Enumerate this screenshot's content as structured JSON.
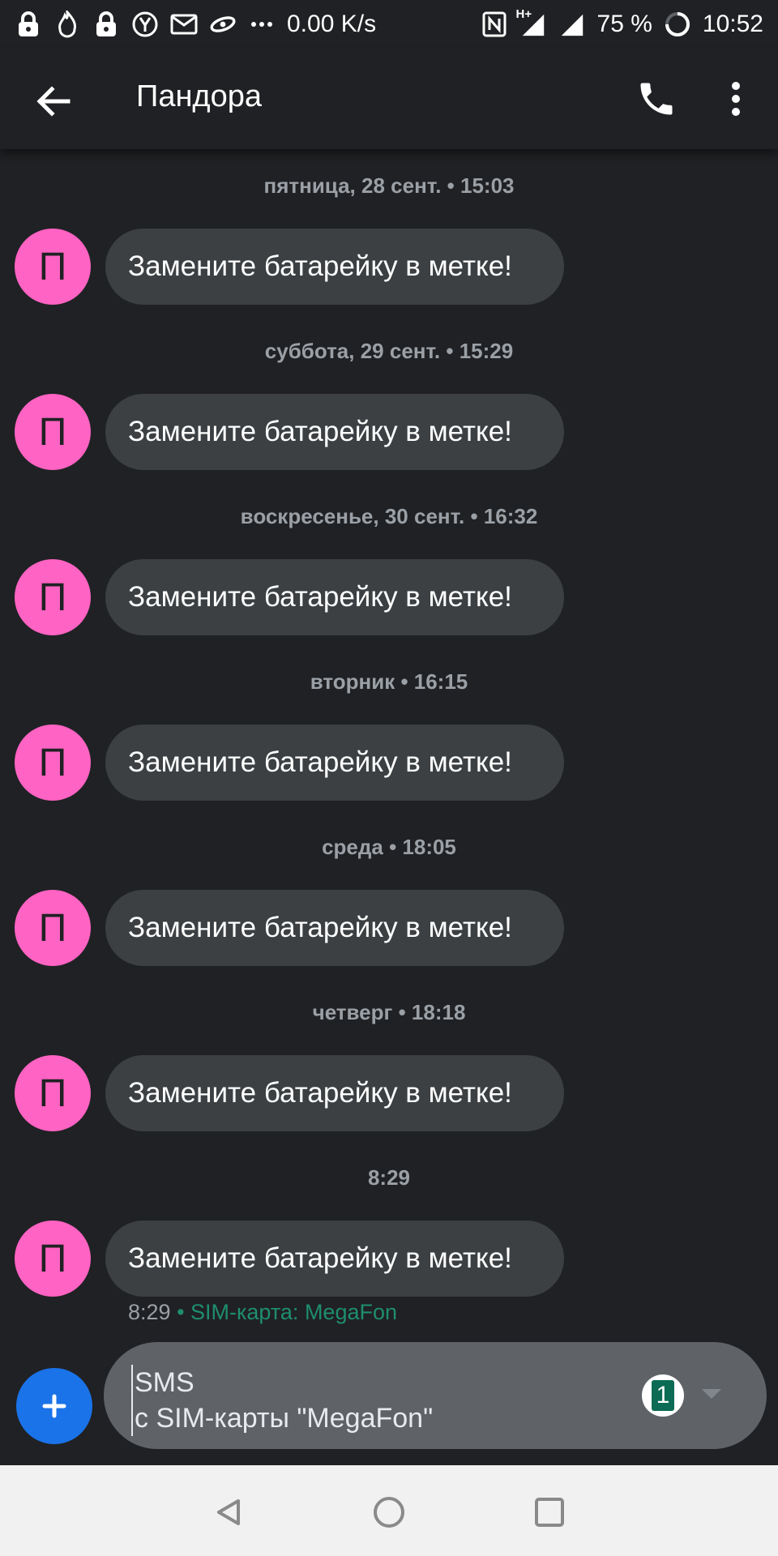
{
  "status_bar": {
    "speed": "0.00 K/s",
    "network": "H+",
    "battery": "75 %",
    "time": "10:52"
  },
  "app_bar": {
    "title": "Пандора"
  },
  "conversation": {
    "avatar_letter": "П",
    "messages": [
      {
        "timestamp": "пятница, 28 сент. • 15:03",
        "text": "Замените батарейку в метке!"
      },
      {
        "timestamp": "суббота, 29 сент. • 15:29",
        "text": "Замените батарейку в метке!"
      },
      {
        "timestamp": "воскресенье, 30 сент. • 16:32",
        "text": "Замените батарейку в метке!"
      },
      {
        "timestamp": "вторник • 16:15",
        "text": "Замените батарейку в метке!"
      },
      {
        "timestamp": "среда • 18:05",
        "text": "Замените батарейку в метке!"
      },
      {
        "timestamp": "четверг • 18:18",
        "text": "Замените батарейку в метке!"
      },
      {
        "timestamp": "8:29",
        "text": "Замените батарейку в метке!"
      }
    ],
    "last_meta": {
      "time": "8:29",
      "sim": " • SIM-карта: MegaFon"
    }
  },
  "composer": {
    "line1": "SMS",
    "line2": "с SIM-карты \"MegaFon\"",
    "sim_number": "1"
  },
  "colors": {
    "background": "#202124",
    "bubble": "#3c4043",
    "avatar": "#ff63c3",
    "fab": "#1a73e8",
    "sim_accent": "#0b6b54"
  }
}
